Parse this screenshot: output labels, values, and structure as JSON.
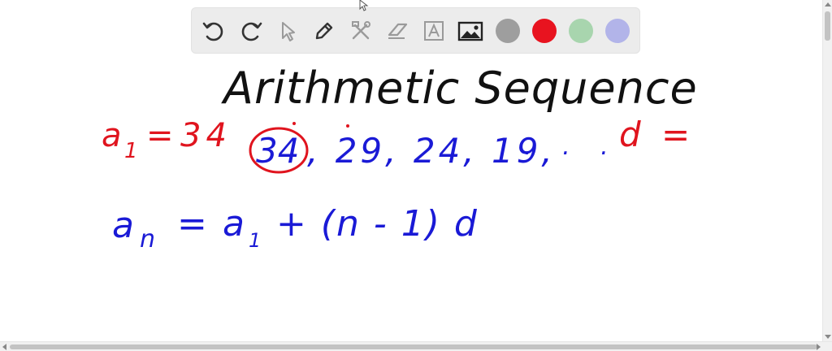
{
  "toolbar": {
    "tools": [
      {
        "name": "undo-icon"
      },
      {
        "name": "redo-icon"
      },
      {
        "name": "pointer-icon"
      },
      {
        "name": "pen-icon"
      },
      {
        "name": "tools-icon"
      },
      {
        "name": "eraser-icon"
      },
      {
        "name": "text-icon"
      },
      {
        "name": "image-icon"
      }
    ],
    "colors": [
      "#9e9e9e",
      "#e8131f",
      "#a8d5ae",
      "#b2b4e9"
    ]
  },
  "whiteboard": {
    "title": "Arithmetic Sequence",
    "first_term": {
      "a": "a",
      "sub": "1",
      "eq": "=",
      "value": "34"
    },
    "sequence": {
      "first": "34",
      "rest": ", 29, 24, 19,",
      "dots": ". . ."
    },
    "difference": "d =",
    "formula": {
      "lhs": "a",
      "lhs_sub": "n",
      "eq": "=",
      "a": "a",
      "sub": "1",
      "rest": "+ (n - 1) d"
    }
  },
  "ink_colors": {
    "black": "#111111",
    "red": "#e0141e",
    "blue": "#1a1ad6"
  }
}
